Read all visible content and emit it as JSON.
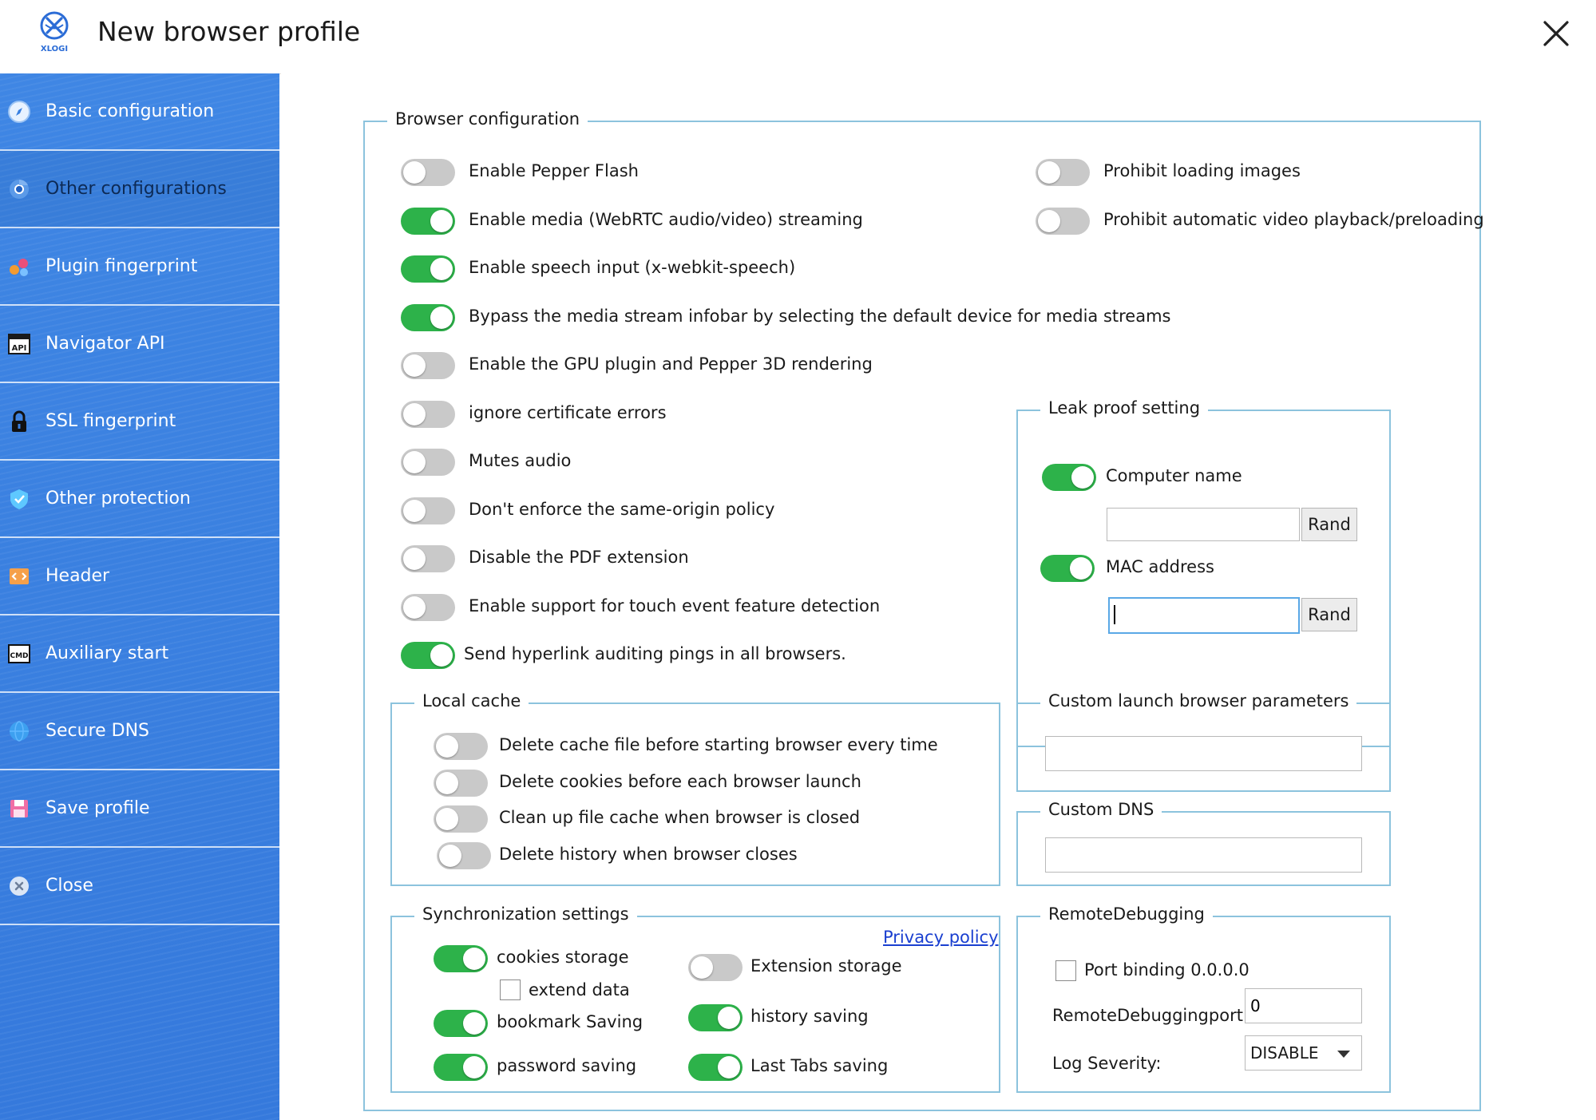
{
  "window": {
    "title": "New browser profile",
    "logo_text": "XLOGI"
  },
  "sidebar": {
    "items": [
      {
        "label": "Basic configuration",
        "icon": "compass-icon"
      },
      {
        "label": "Other configurations",
        "icon": "chrome-icon"
      },
      {
        "label": "Plugin fingerprint",
        "icon": "plugin-icon"
      },
      {
        "label": "Navigator API",
        "icon": "api-icon"
      },
      {
        "label": "SSL fingerprint",
        "icon": "lock-icon"
      },
      {
        "label": "Other protection",
        "icon": "shield-icon"
      },
      {
        "label": "Header",
        "icon": "html-icon"
      },
      {
        "label": "Auxiliary start",
        "icon": "cmd-icon"
      },
      {
        "label": "Secure DNS",
        "icon": "globe-icon"
      },
      {
        "label": "Save profile",
        "icon": "save-icon"
      },
      {
        "label": "Close",
        "icon": "close-circle-icon"
      }
    ],
    "active_index": 1,
    "accent_color": "#3a80e0"
  },
  "browser_config": {
    "legend": "Browser configuration",
    "left_options": [
      {
        "label": "Enable Pepper Flash",
        "on": false
      },
      {
        "label": "Enable media (WebRTC audio/video) streaming",
        "on": true
      },
      {
        "label": "Enable speech input (x-webkit-speech)",
        "on": true
      },
      {
        "label": "Bypass the media stream infobar by selecting the default device for media streams",
        "on": true
      },
      {
        "label": "Enable the GPU plugin and Pepper 3D rendering",
        "on": false
      },
      {
        "label": "ignore certificate errors",
        "on": false
      },
      {
        "label": "Mutes audio",
        "on": false
      },
      {
        "label": "Don't enforce the same-origin policy",
        "on": false
      },
      {
        "label": "Disable the PDF extension",
        "on": false
      },
      {
        "label": "Enable support for touch event feature detection",
        "on": false
      },
      {
        "label": "Send hyperlink auditing pings in all browsers.",
        "on": true
      }
    ],
    "right_options": [
      {
        "label": "Prohibit loading images",
        "on": false
      },
      {
        "label": "Prohibit automatic video playback/preloading",
        "on": false
      }
    ]
  },
  "leak_proof": {
    "legend": "Leak proof setting",
    "computer_name": {
      "label": "Computer name",
      "on": true,
      "value": "",
      "rand_label": "Rand"
    },
    "mac_address": {
      "label": "MAC address",
      "on": true,
      "value": "",
      "rand_label": "Rand"
    }
  },
  "local_cache": {
    "legend": "Local cache",
    "options": [
      {
        "label": "Delete cache file before starting browser every time",
        "on": false
      },
      {
        "label": "Delete cookies before each browser launch",
        "on": false
      },
      {
        "label": "Clean up file cache when browser is closed",
        "on": false
      },
      {
        "label": "Delete history when browser closes",
        "on": false
      }
    ]
  },
  "custom_launch": {
    "legend": "Custom launch browser parameters",
    "value": ""
  },
  "custom_dns": {
    "legend": "Custom DNS",
    "value": ""
  },
  "sync": {
    "legend": "Synchronization settings",
    "privacy_link": "Privacy policy",
    "cookies": {
      "label": "cookies storage",
      "on": true
    },
    "extend_data": {
      "label": "extend data",
      "checked": false
    },
    "bookmark": {
      "label": "bookmark Saving",
      "on": true
    },
    "password": {
      "label": "password saving",
      "on": true
    },
    "extension": {
      "label": "Extension storage",
      "on": false
    },
    "history": {
      "label": "history saving",
      "on": true
    },
    "last_tabs": {
      "label": "Last Tabs saving",
      "on": true
    }
  },
  "remote_debugging": {
    "legend": "RemoteDebugging",
    "port_binding": {
      "label": "Port binding 0.0.0.0",
      "checked": false
    },
    "port": {
      "label": "RemoteDebuggingport:",
      "value": "0"
    },
    "log_severity": {
      "label": "Log Severity:",
      "value": "DISABLE"
    }
  },
  "colors": {
    "toggle_on": "#2db24a",
    "toggle_off": "#c9c9c9",
    "frame_border": "#8cc3dd",
    "link": "#1a3fd0"
  }
}
